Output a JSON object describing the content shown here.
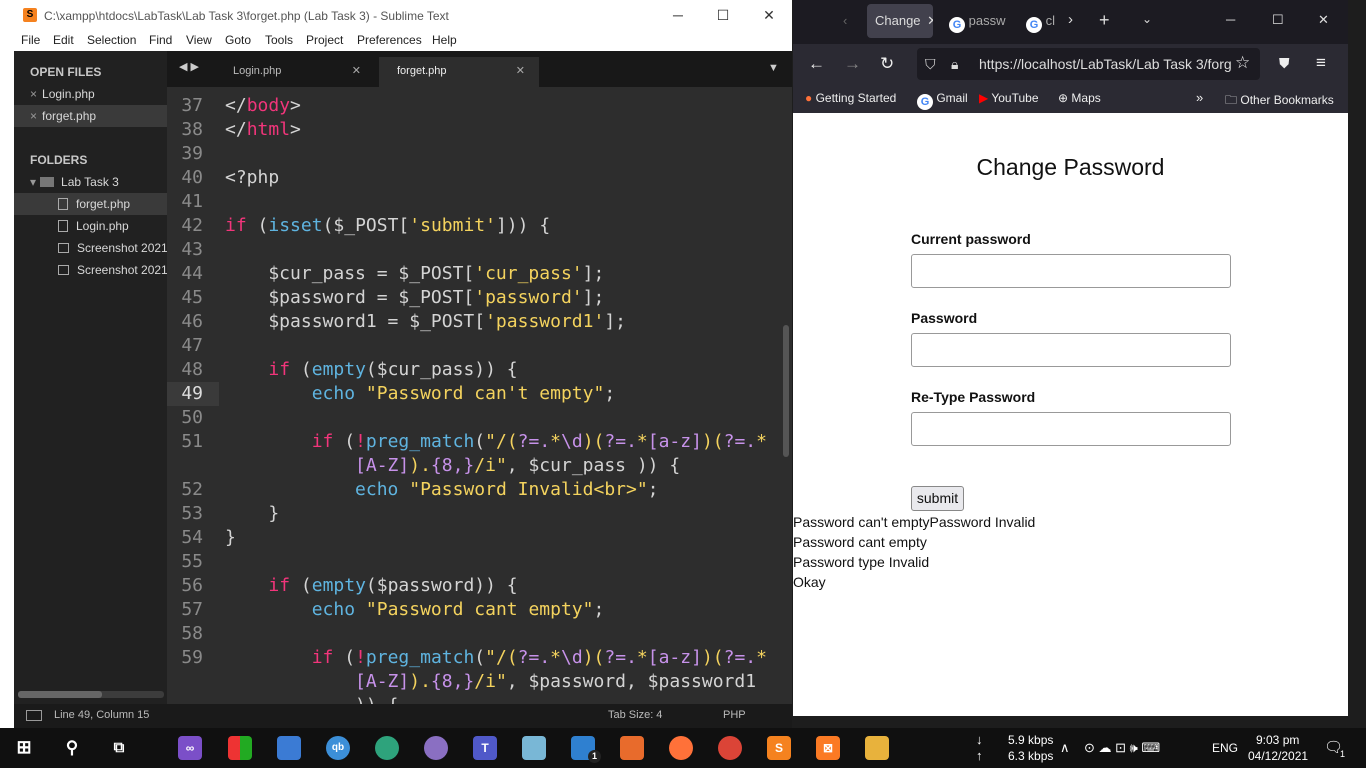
{
  "sublime": {
    "title": "C:\\xampp\\htdocs\\LabTask\\Lab Task 3\\forget.php (Lab Task 3) - Sublime Text",
    "menu": [
      "File",
      "Edit",
      "Selection",
      "Find",
      "View",
      "Goto",
      "Tools",
      "Project",
      "Preferences",
      "Help"
    ],
    "open_files_header": "OPEN FILES",
    "open_files": [
      "Login.php",
      "forget.php"
    ],
    "folders_header": "FOLDERS",
    "folder_name": "Lab Task 3",
    "folder_files": [
      "forget.php",
      "Login.php",
      "Screenshot 2021-",
      "Screenshot 2021-"
    ],
    "tabs": [
      "Login.php",
      "forget.php"
    ],
    "line_numbers": [
      "37",
      "38",
      "39",
      "40",
      "41",
      "42",
      "43",
      "44",
      "45",
      "46",
      "47",
      "48",
      "49",
      "50",
      "51",
      "",
      "52",
      "53",
      "54",
      "55",
      "56",
      "57",
      "58",
      "59",
      ""
    ],
    "status": {
      "position": "Line 49, Column 15",
      "tab_size": "Tab Size: 4",
      "syntax": "PHP"
    }
  },
  "firefox": {
    "tabs": [
      "Change",
      "passw",
      "cl"
    ],
    "url": "https://localhost/LabTask/Lab Task 3/forg",
    "bookmarks": [
      "Getting Started",
      "Gmail",
      "YouTube",
      "Maps",
      "Other Bookmarks"
    ],
    "page": {
      "heading": "Change Password",
      "current_password_label": "Current password",
      "password_label": "Password",
      "retype_label": "Re-Type Password",
      "submit_label": "submit",
      "messages": [
        "Password can't emptyPassword Invalid",
        "Password cant empty",
        "Password type Invalid",
        "Okay"
      ]
    }
  },
  "taskbar": {
    "upload": "5.9 kbps",
    "download": "6.3 kbps",
    "lang": "ENG",
    "time": "9:03 pm",
    "date": "04/12/2021",
    "notif_count": "1",
    "badge": "1"
  }
}
